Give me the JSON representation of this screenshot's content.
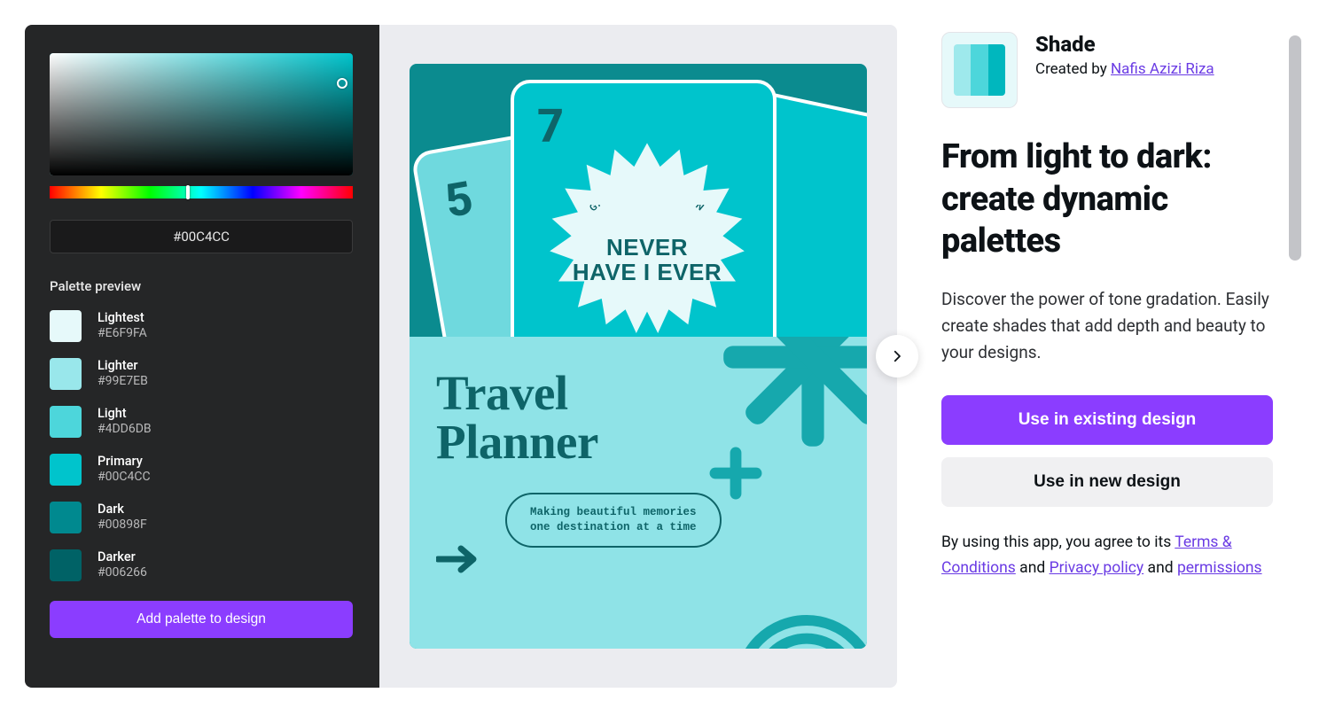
{
  "sidebar": {
    "hex_value": "#00C4CC",
    "preview_label": "Palette preview",
    "swatches": [
      {
        "name": "Lightest",
        "hex": "#E6F9FA"
      },
      {
        "name": "Lighter",
        "hex": "#99E7EB"
      },
      {
        "name": "Light",
        "hex": "#4DD6DB"
      },
      {
        "name": "Primary",
        "hex": "#00C4CC"
      },
      {
        "name": "Dark",
        "hex": "#00898F"
      },
      {
        "name": "Darker",
        "hex": "#006266"
      }
    ],
    "add_button": "Add palette to design"
  },
  "mockup": {
    "card_left_num": "5",
    "card_mid_num": "7",
    "star_sub": "GAME NIGHT EDITION",
    "star_line1": "NEVER",
    "star_line2": "HAVE I EVER",
    "travel_line1": "Travel",
    "travel_line2": "Planner",
    "pill_line1": "Making beautiful memories",
    "pill_line2": "one destination at a time"
  },
  "right": {
    "app_name": "Shade",
    "created_prefix": "Created by ",
    "creator": "Nafis Azizi Riza",
    "headline": "From light to dark: create dynamic palettes",
    "description": "Discover the power of tone gradation. Easily create shades that add depth and beauty to your designs.",
    "btn_primary": "Use in existing design",
    "btn_secondary": "Use in new design",
    "legal_prefix": "By using this app, you agree to its ",
    "terms": "Terms & Conditions",
    "and1": " and ",
    "privacy": "Privacy policy",
    "and2": " and ",
    "permissions": "permissions"
  },
  "icon_colors": [
    "#9ee9ec",
    "#4dd6db",
    "#00b7be"
  ]
}
